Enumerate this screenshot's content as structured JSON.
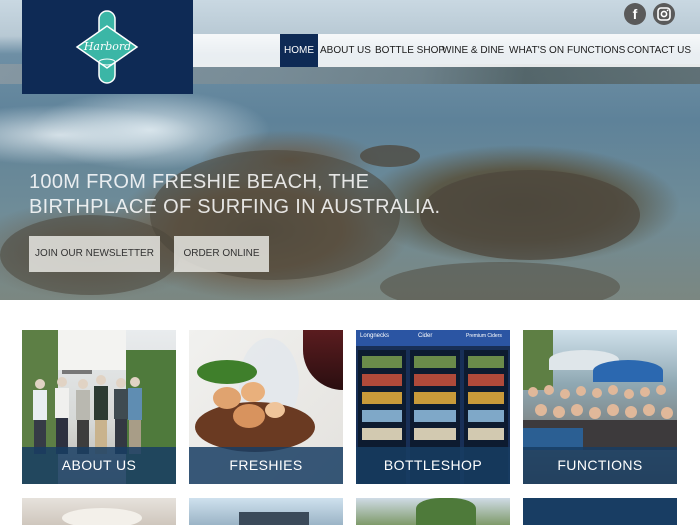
{
  "brand": {
    "logo_text": "Harbord",
    "colors": {
      "navy": "#0e2a55",
      "label_blue": "#183d63",
      "teal": "#3bb6a6"
    }
  },
  "social": [
    {
      "name": "facebook",
      "glyph": "f",
      "icon": "facebook-icon"
    },
    {
      "name": "instagram",
      "glyph": "◎",
      "icon": "instagram-icon"
    }
  ],
  "nav": {
    "items": [
      {
        "label": "HOME",
        "active": true
      },
      {
        "label": "ABOUT US"
      },
      {
        "label": "BOTTLE SHOP"
      },
      {
        "label": "WINE & DINE"
      },
      {
        "label": "WHAT'S ON"
      },
      {
        "label": "FUNCTIONS"
      },
      {
        "label": "CONTACT US"
      }
    ]
  },
  "hero": {
    "tagline_line1": "100M FROM FRESHIE BEACH, THE",
    "tagline_line2": "BIRTHPLACE OF SURFING IN AUSTRALIA.",
    "buttons": {
      "newsletter": "JOIN OUR NEWSLETTER",
      "order": "ORDER ONLINE"
    }
  },
  "cards": [
    {
      "label": "ABOUT US"
    },
    {
      "label": "FRESHIES"
    },
    {
      "label": "BOTTLESHOP",
      "fridge_signs": [
        "Longnecks",
        "Cider",
        "Premium Ciders"
      ]
    },
    {
      "label": "FUNCTIONS"
    }
  ]
}
